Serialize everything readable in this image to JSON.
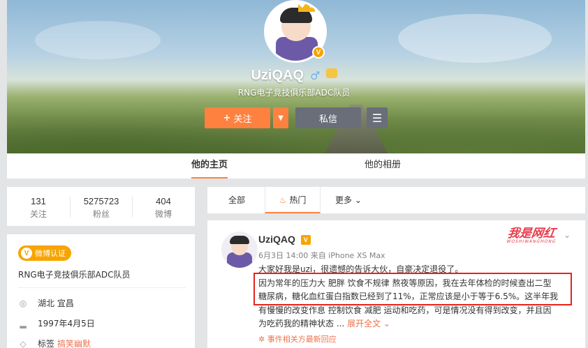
{
  "profile": {
    "username": "UziQAQ",
    "gender_icon": "♂",
    "verified_badge": "V",
    "bio": "RNG电子竞技俱乐部ADC队员"
  },
  "actions": {
    "follow_label": "关注",
    "follow_plus": "+",
    "dropdown_icon": "▼",
    "message_label": "私信",
    "menu_icon": "☰"
  },
  "tabs": [
    {
      "label": "他的主页",
      "active": true
    },
    {
      "label": "他的相册",
      "active": false
    }
  ],
  "stats": [
    {
      "value": "131",
      "label": "关注"
    },
    {
      "value": "5275723",
      "label": "粉丝"
    },
    {
      "value": "404",
      "label": "微博"
    }
  ],
  "info": {
    "verify_tag": "微博认证",
    "verify_icon": "V",
    "verify_text": "RNG电子竞技俱乐部ADC队员",
    "location_icon": "location-pin-icon",
    "location": "湖北 宜昌",
    "birthday_icon": "cake-icon",
    "birthday": "1997年4月5日",
    "tags_icon": "tag-icon",
    "tags_label": "标签",
    "tags_value": "搞笑幽默"
  },
  "filters": [
    {
      "label": "全部"
    },
    {
      "label": "热门",
      "icon": "fire-icon",
      "active": true
    },
    {
      "label": "更多 ⌄"
    }
  ],
  "post": {
    "author": "UziQAQ",
    "author_badge": "V",
    "meta": "6月3日 14:00 来自 iPhone XS Max",
    "watermark": "我是网红",
    "watermark_sub": "WOSHIWANGHONG",
    "chevron": "⌄",
    "text_line1": "大家好我是uzi，很遗憾的告诉大伙，自豪决定退役了。",
    "text_line2": "因为常年的压力大 肥胖 饮食不规律 熬夜等原因，我在去年体检的时候查出二型",
    "text_line3": "糖尿病，糖化血红蛋白指数已经到了11%，正常应该是小于等于6.5%。这半年我",
    "text_line4": "有慢慢的改变作息 控制饮食 减肥 运动和吃药，可是情况没有得到改变，并且因",
    "text_line5": "为吃药我的精神状态 ...",
    "expand_label": "展开全文 ⌄",
    "related_label": "✲ 事件相关方最新回应"
  },
  "colors": {
    "accent": "#ff8140",
    "highlight_box": "#e8221b",
    "link": "#eb7350"
  }
}
